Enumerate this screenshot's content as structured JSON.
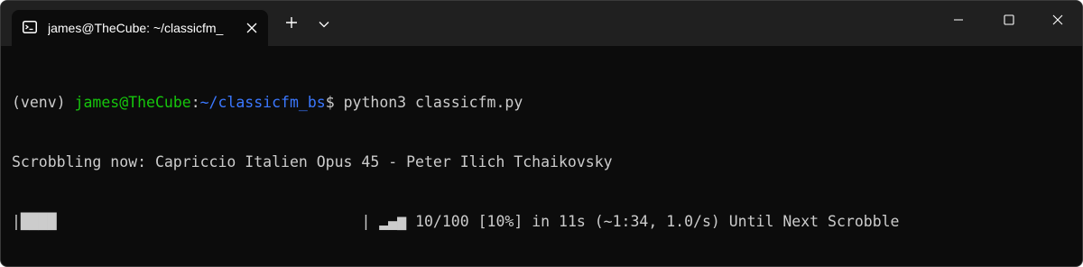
{
  "window": {
    "tab_title": "james@TheCube: ~/classicfm_",
    "tab_icon": "terminal-icon",
    "new_tab_icon": "plus-icon",
    "dropdown_icon": "chevron-down-icon",
    "minimize_icon": "minimize-icon",
    "maximize_icon": "maximize-icon",
    "close_icon": "close-icon"
  },
  "terminal": {
    "prompt": {
      "venv": "(venv) ",
      "user_host": "james@TheCube",
      "separator": ":",
      "path": "~/classicfm_bs",
      "symbol": "$ ",
      "command": "python3 classicfm.py"
    },
    "scrobbling_line": "Scrobbling now: Capriccio Italien Opus 45 - Peter Ilich Tchaikovsky",
    "progress": {
      "left_edge": "|",
      "bar": "████",
      "right_edge": "|",
      "spinner": " ▂▄▆ ",
      "status": "10/100 [10%] in 11s (~1:34, 1.0/s) Until Next Scrobble",
      "fraction": 0.1
    }
  },
  "colors": {
    "background": "#0c0c0c",
    "titlebar": "#202020",
    "text": "#cccccc",
    "user_host": "#16c60c",
    "path": "#3b78ff"
  }
}
